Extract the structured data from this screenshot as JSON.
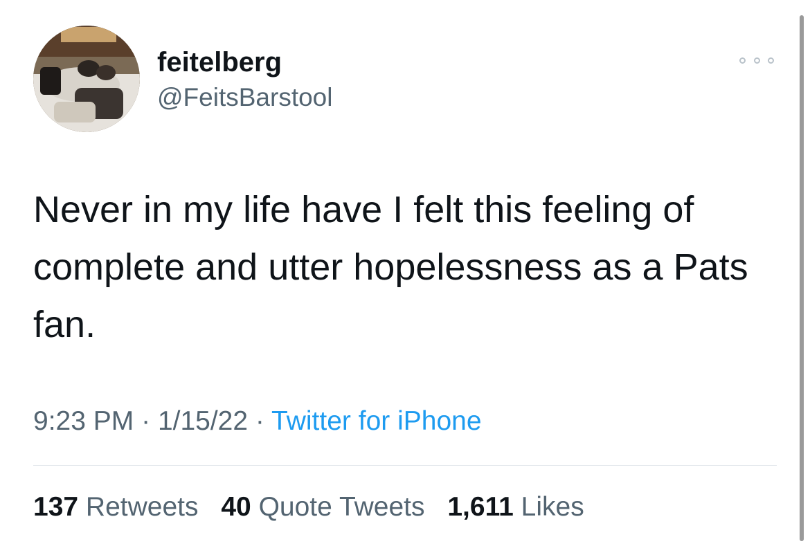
{
  "user": {
    "display_name": "feitelberg",
    "handle": "@FeitsBarstool"
  },
  "tweet": {
    "text": "Never in my life have I felt this feeling of complete and utter hopelessness as a Pats fan."
  },
  "meta": {
    "time": "9:23 PM",
    "date": "1/15/22",
    "source": "Twitter for iPhone",
    "separator": "·"
  },
  "stats": {
    "retweets_count": "137",
    "retweets_label": "Retweets",
    "quotes_count": "40",
    "quotes_label": "Quote Tweets",
    "likes_count": "1,611",
    "likes_label": "Likes"
  },
  "icons": {
    "more": "more-dots-icon"
  },
  "colors": {
    "link": "#1d9bf0",
    "secondary_text": "#536471",
    "primary_text": "#0f1419",
    "divider": "#e1e6ea"
  }
}
